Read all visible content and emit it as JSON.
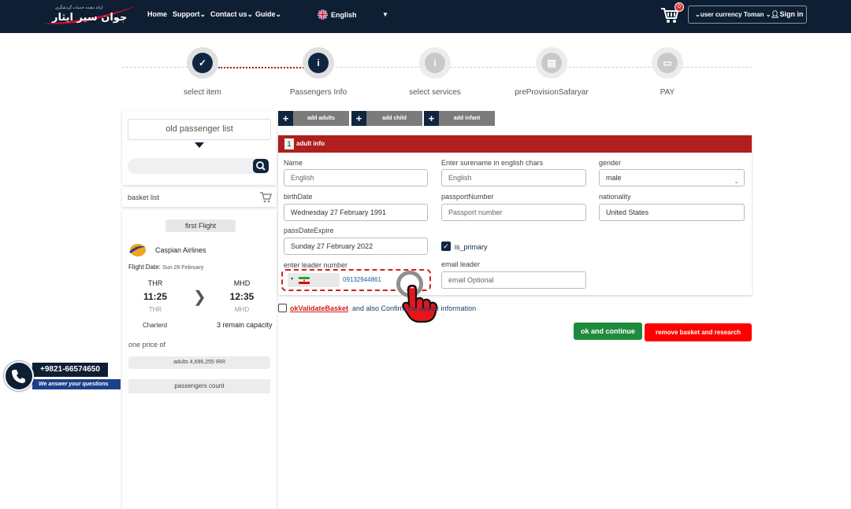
{
  "header": {
    "logo_tagline": "ارائه دهنده خدمات گردشگری",
    "brand": "جوان سیر ایثار",
    "nav": [
      {
        "label": "Home"
      },
      {
        "label": "Support"
      },
      {
        "label": "Contact us"
      },
      {
        "label": "Guide"
      }
    ],
    "language": "English",
    "cart_count": "0",
    "currency": "user currency Toman",
    "sign_in": "Sign in"
  },
  "steps": [
    {
      "label": "select item",
      "state": "done",
      "icon": "check-icon"
    },
    {
      "label": "Passengers Info",
      "state": "current",
      "icon": "info-icon"
    },
    {
      "label": "select services",
      "state": "pending",
      "icon": "info-icon"
    },
    {
      "label": "preProvisionSafaryar",
      "state": "pending",
      "icon": "document-icon"
    },
    {
      "label": "PAY",
      "state": "pending",
      "icon": "card-icon"
    }
  ],
  "sidebar": {
    "old_passenger_list": "old passenger list",
    "basket_list": "basket list",
    "flight_tab": "first Flight",
    "airline": "Caspian Airlines",
    "flight_date_label": "Flight Date:",
    "flight_date": "Sun 28 February",
    "origin_code": "THR",
    "origin_time": "11:25",
    "origin_sub": "THR",
    "dest_code": "MHD",
    "dest_time": "12:35",
    "dest_sub": "MHD",
    "charter": "Charterd",
    "capacity": "3 remain capacity",
    "one_price": "one price of",
    "price_line": "adults 4,696,255 IRR",
    "passengers_count": "passengers count"
  },
  "add_buttons": {
    "adults": "add adults",
    "child": "add child",
    "infant": "add infant"
  },
  "form": {
    "index": "1",
    "title": "adult info",
    "name_label": "Name",
    "name_placeholder": "English",
    "surname_label": "Enter surename in english chars",
    "surname_placeholder": "English",
    "gender_label": "gender",
    "gender_value": "male",
    "birth_label": "birthDate",
    "birth_value": "Wednesday 27 February 1991",
    "passport_label": "passportNumber",
    "passport_placeholder": "Passport number",
    "nationality_label": "nationality",
    "nationality_value": "United States",
    "expire_label": "passDateExpire",
    "expire_value": "Sunday 27 February 2022",
    "primary_label": "is_primary",
    "leader_label": "enter leader number",
    "leader_value": "09132944861",
    "email_label": "email leader",
    "email_placeholder": "email Optional"
  },
  "confirm": {
    "link": "okValidateBasket",
    "text": "and also Confirm the above information"
  },
  "actions": {
    "ok": "ok and continue",
    "remove": "remove basket and research"
  },
  "support": {
    "phone": "+9821-66574650",
    "answer": "We answer your questions"
  },
  "colors": {
    "navy": "#0e1e33",
    "accent_red": "#b11e1e",
    "ok_green": "#1e8a3b",
    "remove_red": "#ff0000"
  }
}
